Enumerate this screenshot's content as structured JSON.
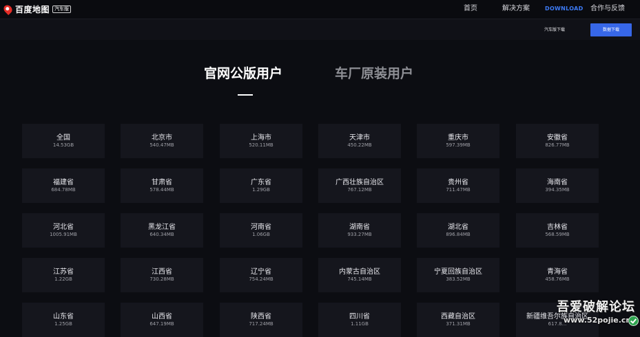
{
  "brand": {
    "name": "百度地图",
    "badge": "汽车版"
  },
  "nav": {
    "home": "首页",
    "solutions": "解决方案",
    "download": "DOWNLOAD",
    "cooperation": "合作与反馈"
  },
  "subnav": {
    "car_download": "汽车版下载",
    "data_download": "数据下载"
  },
  "tabs": {
    "official": "官网公版用户",
    "oem": "车厂原装用户"
  },
  "regions": [
    {
      "name": "全国",
      "size": "14.53GB"
    },
    {
      "name": "北京市",
      "size": "540.47MB"
    },
    {
      "name": "上海市",
      "size": "520.11MB"
    },
    {
      "name": "天津市",
      "size": "450.22MB"
    },
    {
      "name": "重庆市",
      "size": "597.39MB"
    },
    {
      "name": "安徽省",
      "size": "826.77MB"
    },
    {
      "name": "福建省",
      "size": "684.78MB"
    },
    {
      "name": "甘肃省",
      "size": "578.44MB"
    },
    {
      "name": "广东省",
      "size": "1.29GB"
    },
    {
      "name": "广西壮族自治区",
      "size": "767.12MB"
    },
    {
      "name": "贵州省",
      "size": "711.47MB"
    },
    {
      "name": "海南省",
      "size": "394.35MB"
    },
    {
      "name": "河北省",
      "size": "1005.91MB"
    },
    {
      "name": "黑龙江省",
      "size": "640.34MB"
    },
    {
      "name": "河南省",
      "size": "1.06GB"
    },
    {
      "name": "湖南省",
      "size": "933.27MB"
    },
    {
      "name": "湖北省",
      "size": "896.84MB"
    },
    {
      "name": "吉林省",
      "size": "568.59MB"
    },
    {
      "name": "江苏省",
      "size": "1.22GB"
    },
    {
      "name": "江西省",
      "size": "730.28MB"
    },
    {
      "name": "辽宁省",
      "size": "754.24MB"
    },
    {
      "name": "内蒙古自治区",
      "size": "745.14MB"
    },
    {
      "name": "宁夏回族自治区",
      "size": "383.52MB"
    },
    {
      "name": "青海省",
      "size": "458.76MB"
    },
    {
      "name": "山东省",
      "size": "1.25GB"
    },
    {
      "name": "山西省",
      "size": "647.19MB"
    },
    {
      "name": "陕西省",
      "size": "717.24MB"
    },
    {
      "name": "四川省",
      "size": "1.11GB"
    },
    {
      "name": "西藏自治区",
      "size": "371.31MB"
    },
    {
      "name": "新疆维吾尔族自治区",
      "size": "617.8..."
    }
  ],
  "watermark": {
    "title": "吾爱破解论坛",
    "url": "www.52pojie.cn"
  },
  "colors": {
    "background": "#0c0d12",
    "card": "#15161d",
    "accent": "#3767e8"
  }
}
